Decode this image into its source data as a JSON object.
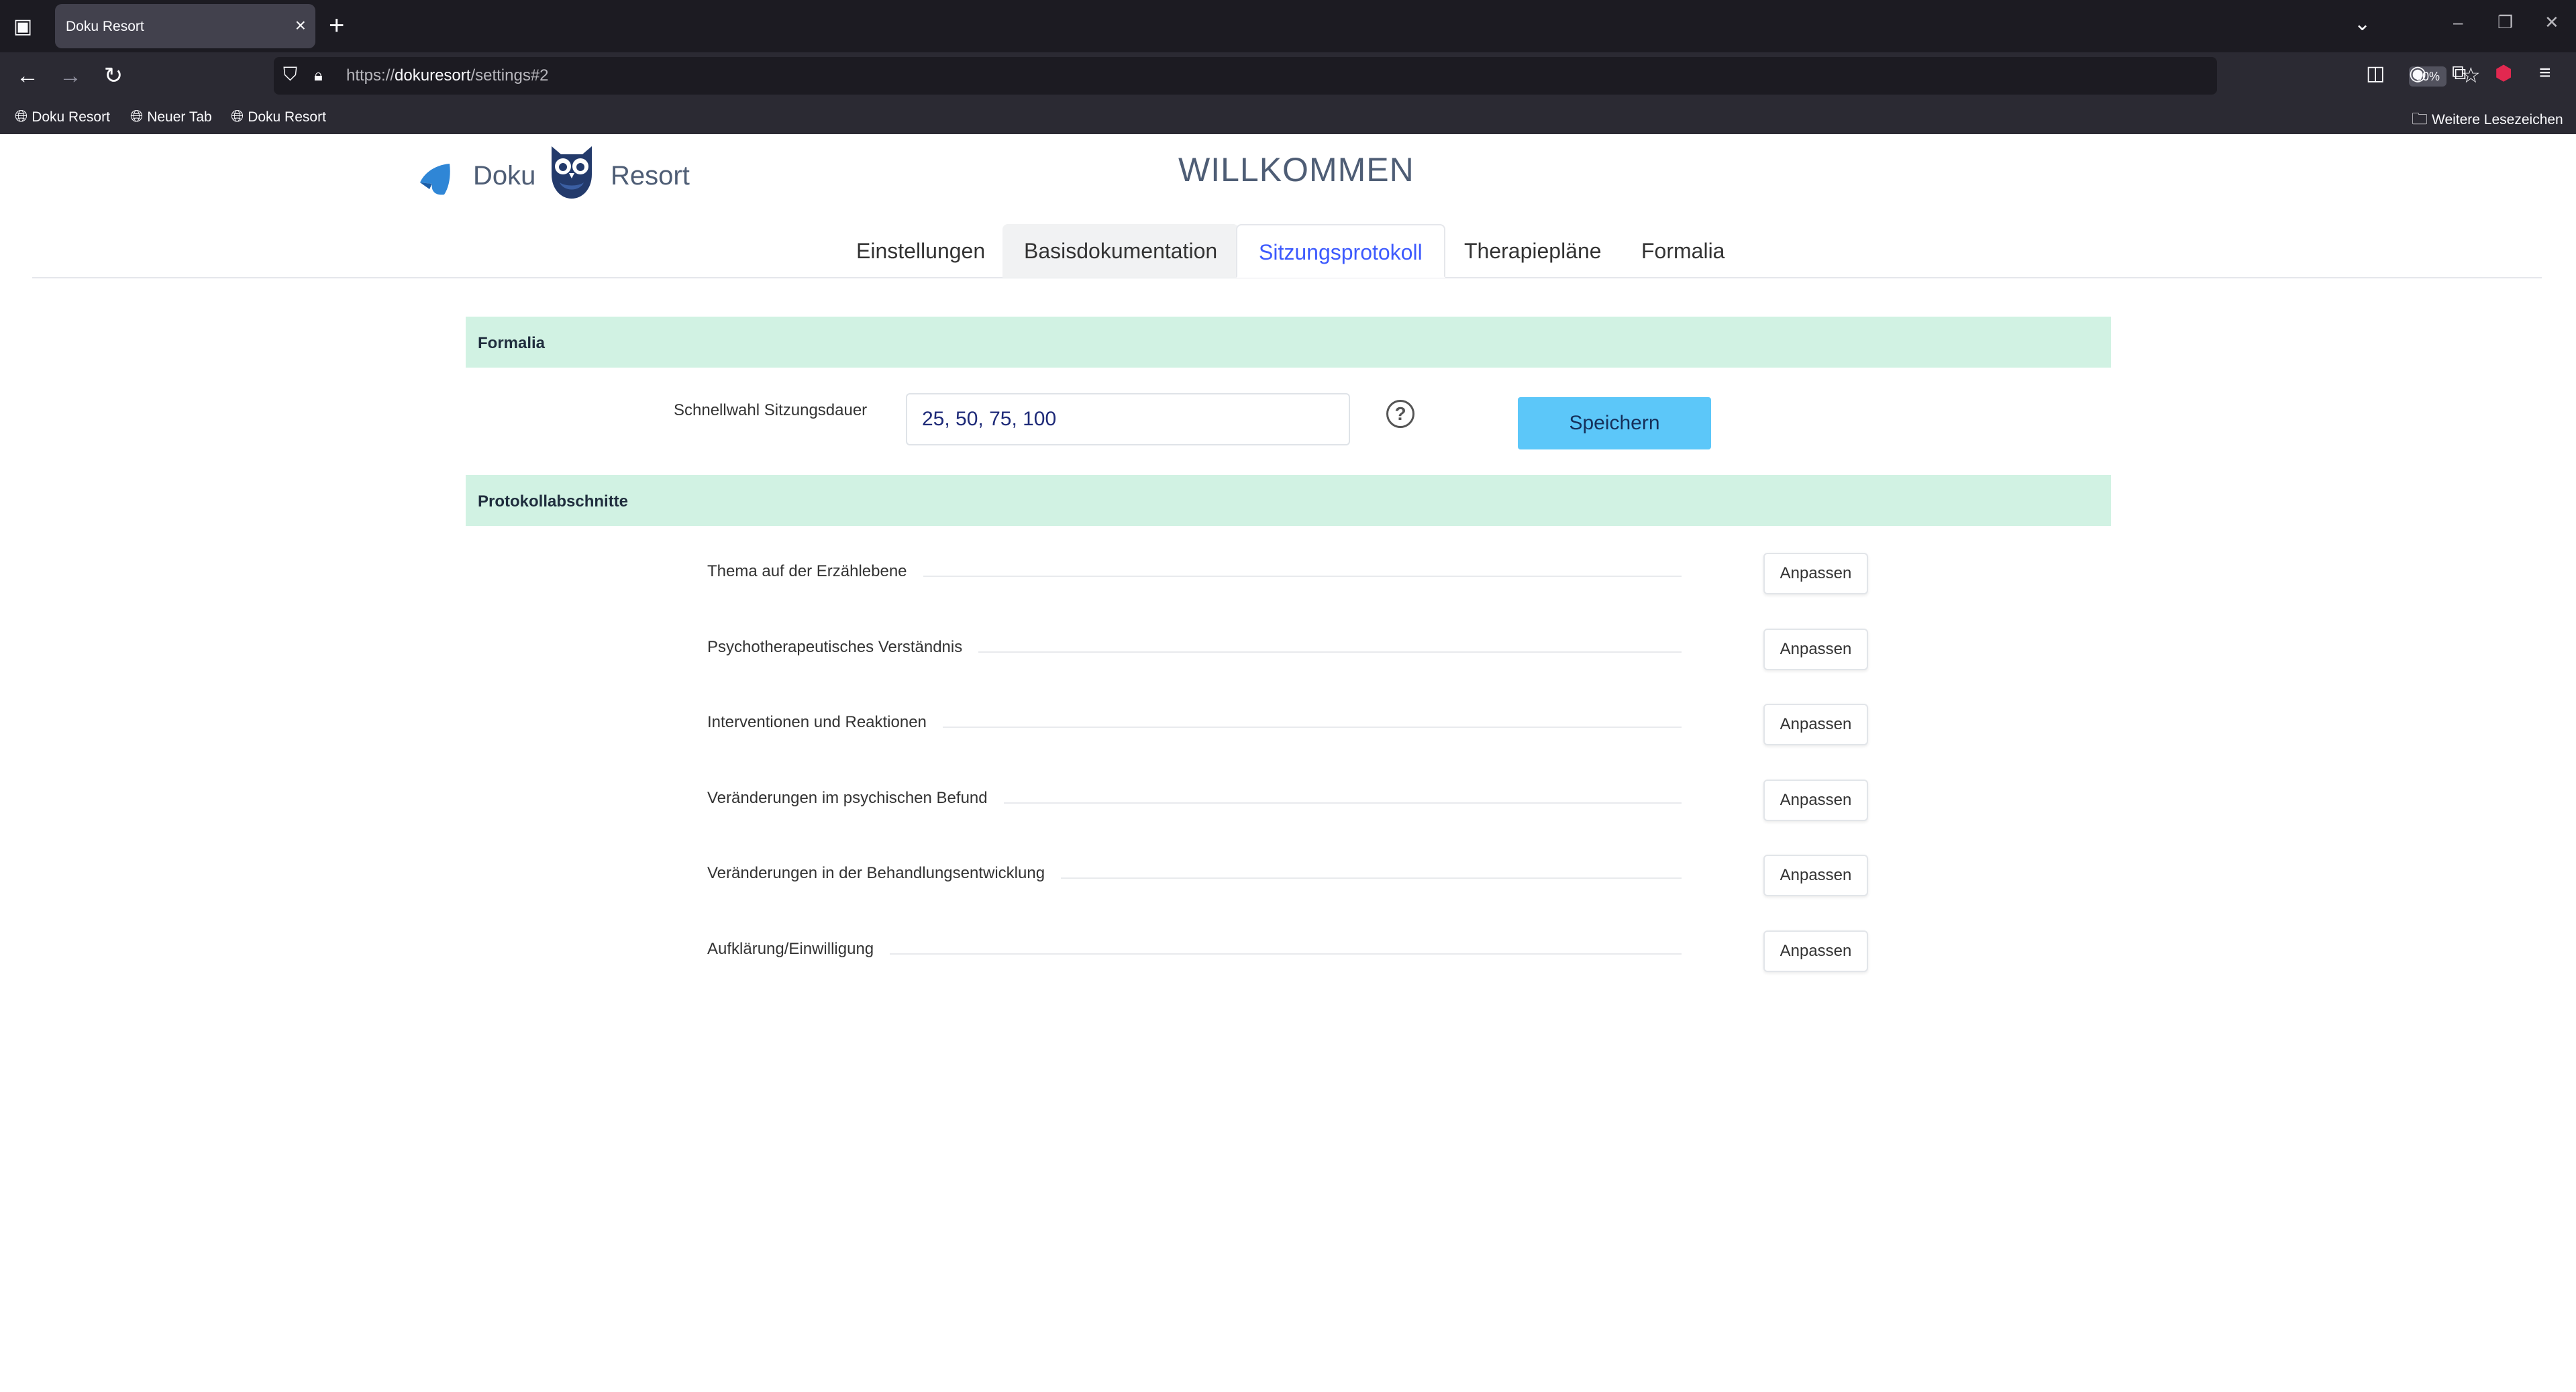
{
  "browser": {
    "tab_title": "Doku Resort",
    "url_prefix": "https://",
    "url_host": "dokuresort",
    "url_path": "/settings#2",
    "zoom": "90%",
    "bookmarks": [
      "Doku Resort",
      "Neuer Tab",
      "Doku Resort"
    ],
    "other_bookmarks": "Weitere Lesezeichen"
  },
  "header": {
    "logo_left": "Doku",
    "logo_right": "Resort",
    "title": "WILLKOMMEN"
  },
  "nav_tabs": [
    {
      "label": "Einstellungen"
    },
    {
      "label": "Basisdokumentation"
    },
    {
      "label": "Sitzungsprotokoll"
    },
    {
      "label": "Therapiepläne"
    },
    {
      "label": "Formalia"
    }
  ],
  "formalia": {
    "section_title": "Formalia",
    "field_label": "Schnellwahl Sitzungsdauer",
    "field_value": "25, 50, 75, 100",
    "help_symbol": "?",
    "save_label": "Speichern"
  },
  "protokoll": {
    "section_title": "Protokollabschnitte",
    "button_label": "Anpassen",
    "items": [
      "Thema auf der Erzählebene",
      "Psychotherapeutisches Verständnis",
      "Interventionen und Reaktionen",
      "Veränderungen im psychischen Befund",
      "Veränderungen in der Behandlungsentwicklung",
      "Aufklärung/Einwilligung"
    ]
  },
  "colors": {
    "section_bg": "#d1f2e3",
    "save_button": "#5cc7f9",
    "active_tab": "#3d5afe",
    "brand_text": "#4e5d75"
  }
}
